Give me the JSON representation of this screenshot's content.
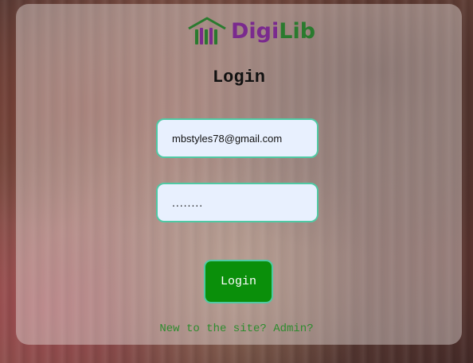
{
  "logo": {
    "text_part1": "Digi",
    "text_part2": "Lib",
    "icon": "library-building-icon"
  },
  "page_title": "Login",
  "form": {
    "email_value": "mbstyles78@gmail.com",
    "password_value": "........"
  },
  "login_button": "Login",
  "links": {
    "new_to_site": "New to the site?",
    "admin": "Admin?"
  },
  "colors": {
    "accent_border": "#4fc9a3",
    "button_bg": "#0a8f0a",
    "link": "#2e8b2e",
    "logo_purple": "#7a2a8e",
    "logo_green": "#2a7a2e"
  }
}
